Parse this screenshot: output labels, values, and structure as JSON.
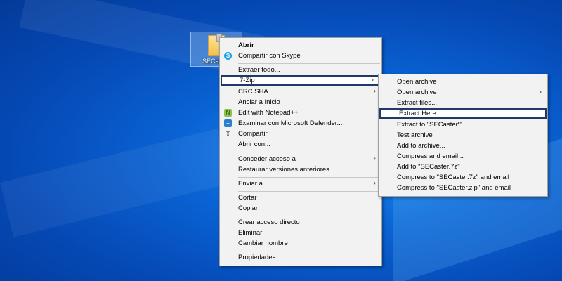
{
  "desktop": {
    "file_label": "SECas"
  },
  "main_menu": {
    "items": [
      {
        "label": "Abrir"
      },
      {
        "label": "Compartir con Skype",
        "icon": "skype-icon"
      },
      {
        "label": "Extraer todo..."
      },
      {
        "label": "7-Zip"
      },
      {
        "label": "CRC SHA"
      },
      {
        "label": "Anclar a Inicio"
      },
      {
        "label": "Edit with Notepad++",
        "icon": "notepad-plus-plus-icon"
      },
      {
        "label": "Examinar con Microsoft Defender...",
        "icon": "defender-shield-icon"
      },
      {
        "label": "Compartir",
        "icon": "share-icon"
      },
      {
        "label": "Abrir con..."
      },
      {
        "label": "Conceder acceso a"
      },
      {
        "label": "Restaurar versiones anteriores"
      },
      {
        "label": "Enviar a"
      },
      {
        "label": "Cortar"
      },
      {
        "label": "Copiar"
      },
      {
        "label": "Crear acceso directo"
      },
      {
        "label": "Eliminar"
      },
      {
        "label": "Cambiar nombre"
      },
      {
        "label": "Propiedades"
      }
    ]
  },
  "sub_menu": {
    "items": [
      {
        "label": "Open archive"
      },
      {
        "label": "Open archive"
      },
      {
        "label": "Extract files..."
      },
      {
        "label": "Extract Here"
      },
      {
        "label": "Extract to \"SECaster\\\""
      },
      {
        "label": "Test archive"
      },
      {
        "label": "Add to archive..."
      },
      {
        "label": "Compress and email..."
      },
      {
        "label": "Add to \"SECaster.7z\""
      },
      {
        "label": "Compress to \"SECaster.7z\" and email"
      },
      {
        "label": "Compress to \"SECaster.zip\" and email"
      }
    ]
  },
  "glyphs": {
    "chevron": "›",
    "skype": "S",
    "npp": "N",
    "shield": "+",
    "share": "⇪"
  }
}
